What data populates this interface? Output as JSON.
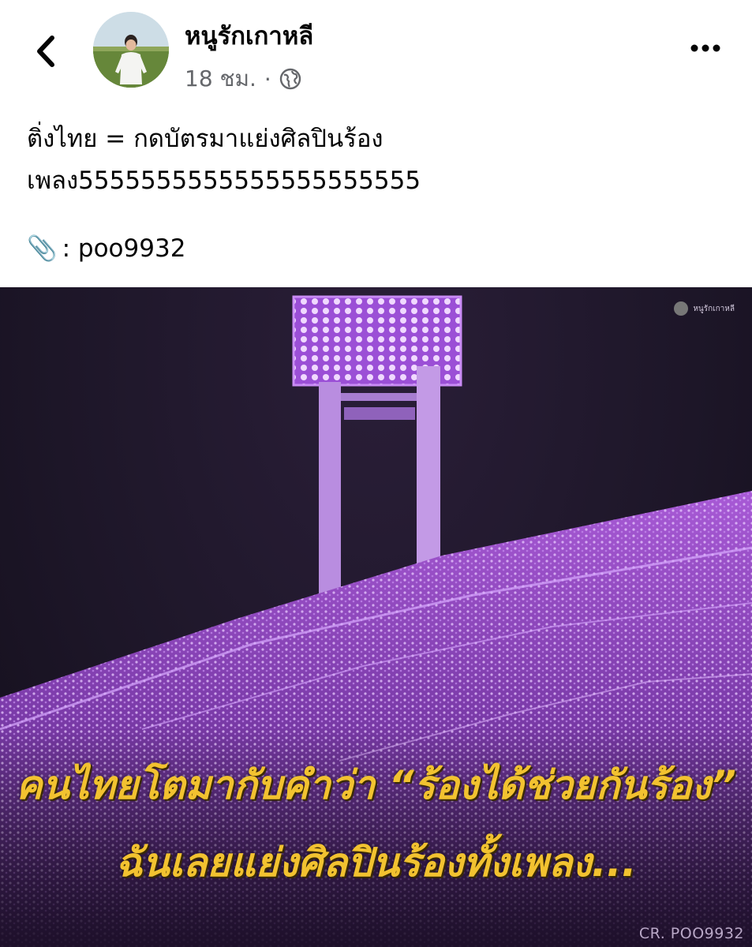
{
  "post": {
    "author": "หนูรักเกาหลี",
    "time": "18 ชม.",
    "separator": "·",
    "audience_icon": "globe-icon",
    "text_line1": "ติ่งไทย = กดบัตรมาแย่งศิลปินร้อง",
    "text_line2": "เพลง5555555555555555555555",
    "attachment_emoji": "📎",
    "attachment_text": ": poo9932"
  },
  "header": {
    "back_icon": "chevron-left-icon",
    "more_icon": "more-horizontal-icon"
  },
  "photo": {
    "caption_line1": "คนไทยโตมากับคำว่า “ร้องได้ช่วยกันร้อง”",
    "caption_line2": "ฉันเลยแย่งศิลปินร้องทั้งเพลง...",
    "credit": "CR. POO9932",
    "watermark": "หนูรักเกาหลี",
    "accent_color": "#b45cf0",
    "caption_color": "#f2c230"
  }
}
